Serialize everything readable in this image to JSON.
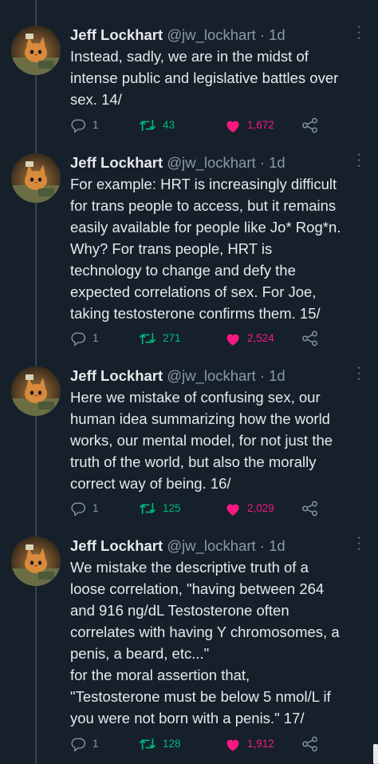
{
  "colors": {
    "background": "#15202b",
    "thread_line": "#38444d",
    "muted": "#8b98a5",
    "retweet_green": "#00ba7c",
    "like_pink": "#f91880"
  },
  "icons": {
    "more": "more-vertical-icon",
    "reply": "reply-icon",
    "retweet": "retweet-icon",
    "like": "heart-icon",
    "share": "share-icon"
  },
  "tweets": [
    {
      "name": "Jeff Lockhart",
      "handle": "@jw_lockhart",
      "separator": "·",
      "time": "1d",
      "text": "Instead, sadly, we are in the midst of\nintense public and legislative battles over\nsex. 14/",
      "replies": "1",
      "retweets": "43",
      "likes": "1,672",
      "liked": true
    },
    {
      "name": "Jeff Lockhart",
      "handle": "@jw_lockhart",
      "separator": "·",
      "time": "1d",
      "text": "For example: HRT is increasingly difficult\nfor trans people to access, but it remains\neasily available for people like Jo* Rog*n.\nWhy? For trans people, HRT is\ntechnology to change and defy the\nexpected correlations of sex. For Joe,\ntaking testosterone confirms them. 15/",
      "replies": "1",
      "retweets": "271",
      "likes": "2,524",
      "liked": true
    },
    {
      "name": "Jeff Lockhart",
      "handle": "@jw_lockhart",
      "separator": "·",
      "time": "1d",
      "text": "Here we mistake of confusing sex, our\nhuman idea summarizing how the world\nworks, our mental model, for not just the\ntruth of the world, but also the morally\ncorrect way of being. 16/",
      "replies": "1",
      "retweets": "125",
      "likes": "2,029",
      "liked": true
    },
    {
      "name": "Jeff Lockhart",
      "handle": "@jw_lockhart",
      "separator": "·",
      "time": "1d",
      "text": "We mistake the descriptive truth of a\nloose correlation, \"having between 264\nand 916 ng/dL Testosterone often\ncorrelates with having Y chromosomes, a\npenis, a beard, etc...\"\nfor the moral assertion that,\n\"Testosterone must be below 5 nmol/L if\nyou were not born with a penis.\" 17/",
      "replies": "1",
      "retweets": "128",
      "likes": "1,912",
      "liked": true
    }
  ]
}
